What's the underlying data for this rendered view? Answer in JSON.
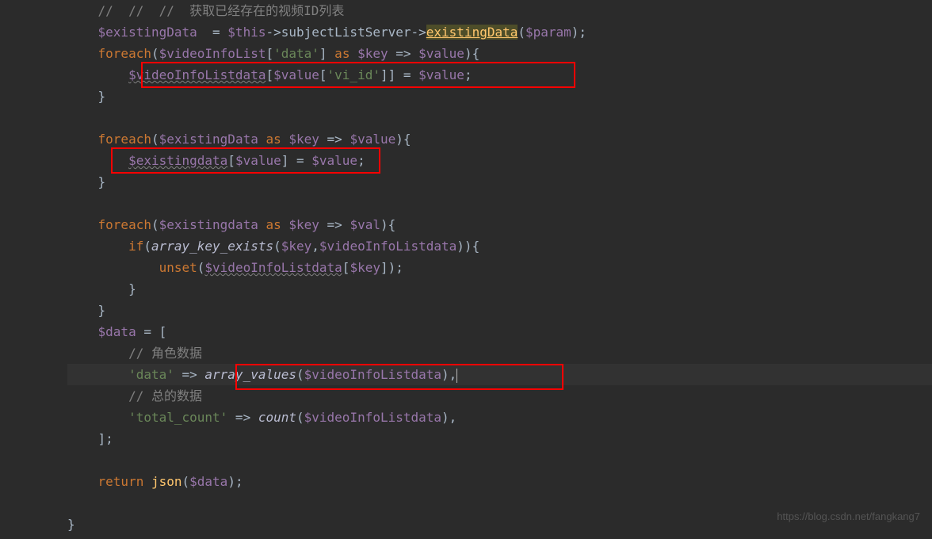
{
  "code": {
    "line1": {
      "comment": "//  //  //  获取已经存在的视频ID列表"
    },
    "line2": {
      "var1": "$existingData",
      "eq": "  = ",
      "var2": "$this",
      "arrow1": "->",
      "prop1": "subjectListServer",
      "arrow2": "->",
      "method": "existingData",
      "open": "(",
      "var3": "$param",
      "close": ");"
    },
    "line3": {
      "kw": "foreach",
      "open": "(",
      "var1": "$videoInfoList",
      "bracket": "[",
      "str": "'data'",
      "bracket2": "]",
      "as": " as ",
      "var2": "$key",
      "arrow": " => ",
      "var3": "$value",
      "close": "){"
    },
    "line4": {
      "var1": "$videoInfoListdata",
      "open": "[",
      "var2": "$value",
      "open2": "[",
      "str": "'vi_id'",
      "close2": "]] = ",
      "var3": "$value",
      "semi": ";"
    },
    "line5": {
      "brace": "}"
    },
    "line7": {
      "kw": "foreach",
      "open": "(",
      "var1": "$existingData",
      "as": " as ",
      "var2": "$key",
      "arrow": " => ",
      "var3": "$value",
      "close": "){"
    },
    "line8": {
      "var1": "$existingdata",
      "open": "[",
      "var2": "$value",
      "close": "] = ",
      "var3": "$value",
      "semi": ";"
    },
    "line9": {
      "brace": "}"
    },
    "line11": {
      "kw": "foreach",
      "open": "(",
      "var1": "$existingdata",
      "as": " as ",
      "var2": "$key",
      "arrow": " => ",
      "var3": "$val",
      "close": "){"
    },
    "line12": {
      "kw": "if",
      "open": "(",
      "func": "array_key_exists",
      "open2": "(",
      "var1": "$key",
      "comma": ",",
      "var2": "$videoInfoListdata",
      "close": ")){"
    },
    "line13": {
      "func": "unset",
      "open": "(",
      "var1": "$videoInfoListdata",
      "open2": "[",
      "var2": "$key",
      "close": "]);"
    },
    "line14": {
      "brace": "}"
    },
    "line15": {
      "brace": "}"
    },
    "line16": {
      "var": "$data",
      "eq": " = ["
    },
    "line17": {
      "comment": "// 角色数据"
    },
    "line18": {
      "str": "'data'",
      "arrow": " => ",
      "func": "array_values",
      "open": "(",
      "var": "$videoInfoListdata",
      "close": "),"
    },
    "line19": {
      "comment": "// 总的数据"
    },
    "line20": {
      "str": "'total_count'",
      "arrow": " => ",
      "func": "count",
      "open": "(",
      "var": "$videoInfoListdata",
      "close": "),"
    },
    "line21": {
      "close": "];"
    },
    "line23": {
      "kw": "return ",
      "func": "json",
      "open": "(",
      "var": "$data",
      "close": ");"
    },
    "line25": {
      "brace": "}"
    }
  },
  "watermark": "https://blog.csdn.net/fangkang7"
}
